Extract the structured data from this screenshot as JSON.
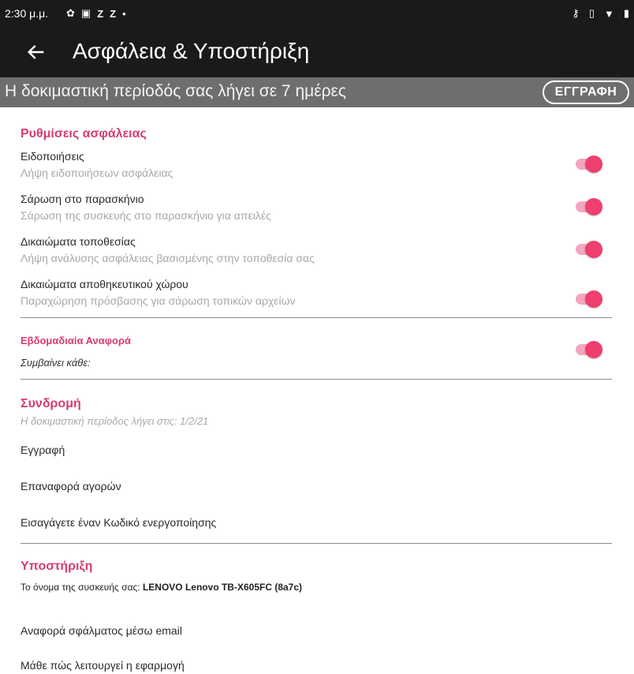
{
  "status_bar": {
    "time": "2:30 μ.μ.",
    "left_icons": [
      "gear-icon",
      "image-icon",
      "z-icon",
      "z-icon",
      "dot-icon"
    ],
    "right_icons": [
      "key-icon",
      "vibrate-icon",
      "wifi-icon",
      "battery-icon"
    ]
  },
  "header": {
    "title": "Ασφάλεια & Υποστήριξη",
    "back_icon": "arrow-left-icon"
  },
  "trial_banner": {
    "text": "Η δοκιμαστική περίοδός σας λήγει σε 7 ημέρες",
    "button_label": "ΕΓΓΡΑΦΗ"
  },
  "security_settings": {
    "title": "Ρυθμίσεις ασφάλειας",
    "items": [
      {
        "title": "Ειδοποιήσεις",
        "subtitle": "Λήψη ειδοποιήσεων ασφάλειας",
        "enabled": true
      },
      {
        "title": "Σάρωση στο παρασκήνιο",
        "subtitle": "Σάρωση της συσκευής στο παρασκήνιο για απειλές",
        "enabled": true
      },
      {
        "title": "Δικαιώματα τοποθεσίας",
        "subtitle": "Λήψη ανάλυσης ασφάλειας βασισμένης στην τοποθεσία σας",
        "enabled": true
      },
      {
        "title": "Δικαιώματα αποθηκευτικού χώρου",
        "subtitle": "Παραχώρηση πρόσβασης για σάρωση τοπικών αρχείων",
        "enabled": true
      }
    ]
  },
  "weekly_report": {
    "title": "Εβδομαδιαία Αναφορά",
    "subtitle": "Συμβαίνει κάθε:",
    "enabled": true
  },
  "subscription": {
    "title": "Συνδρομή",
    "subtitle": "Η δοκιμαστική περίοδος λήγει στις: 1/2/21",
    "items": [
      "Εγγραφή",
      "Επαναφορά αγορών",
      "Εισαγάγετε έναν Κωδικό ενεργοποίησης"
    ]
  },
  "support": {
    "title": "Υποστήριξη",
    "device_label": "Το όνομα της συσκευής σας: ",
    "device_name": "LENOVO Lenovo TB-X605FC (8a7c)",
    "items": [
      "Αναφορά σφάλματος μέσω email",
      "Μάθε πώς λειτουργεί η εφαρμογή"
    ]
  },
  "colors": {
    "accent": "#d83c6c",
    "toggle_thumb": "#ee3f6e",
    "toggle_track": "#f5a5bd",
    "app_bar": "#1a1a1a",
    "banner": "#6e6e6e"
  }
}
